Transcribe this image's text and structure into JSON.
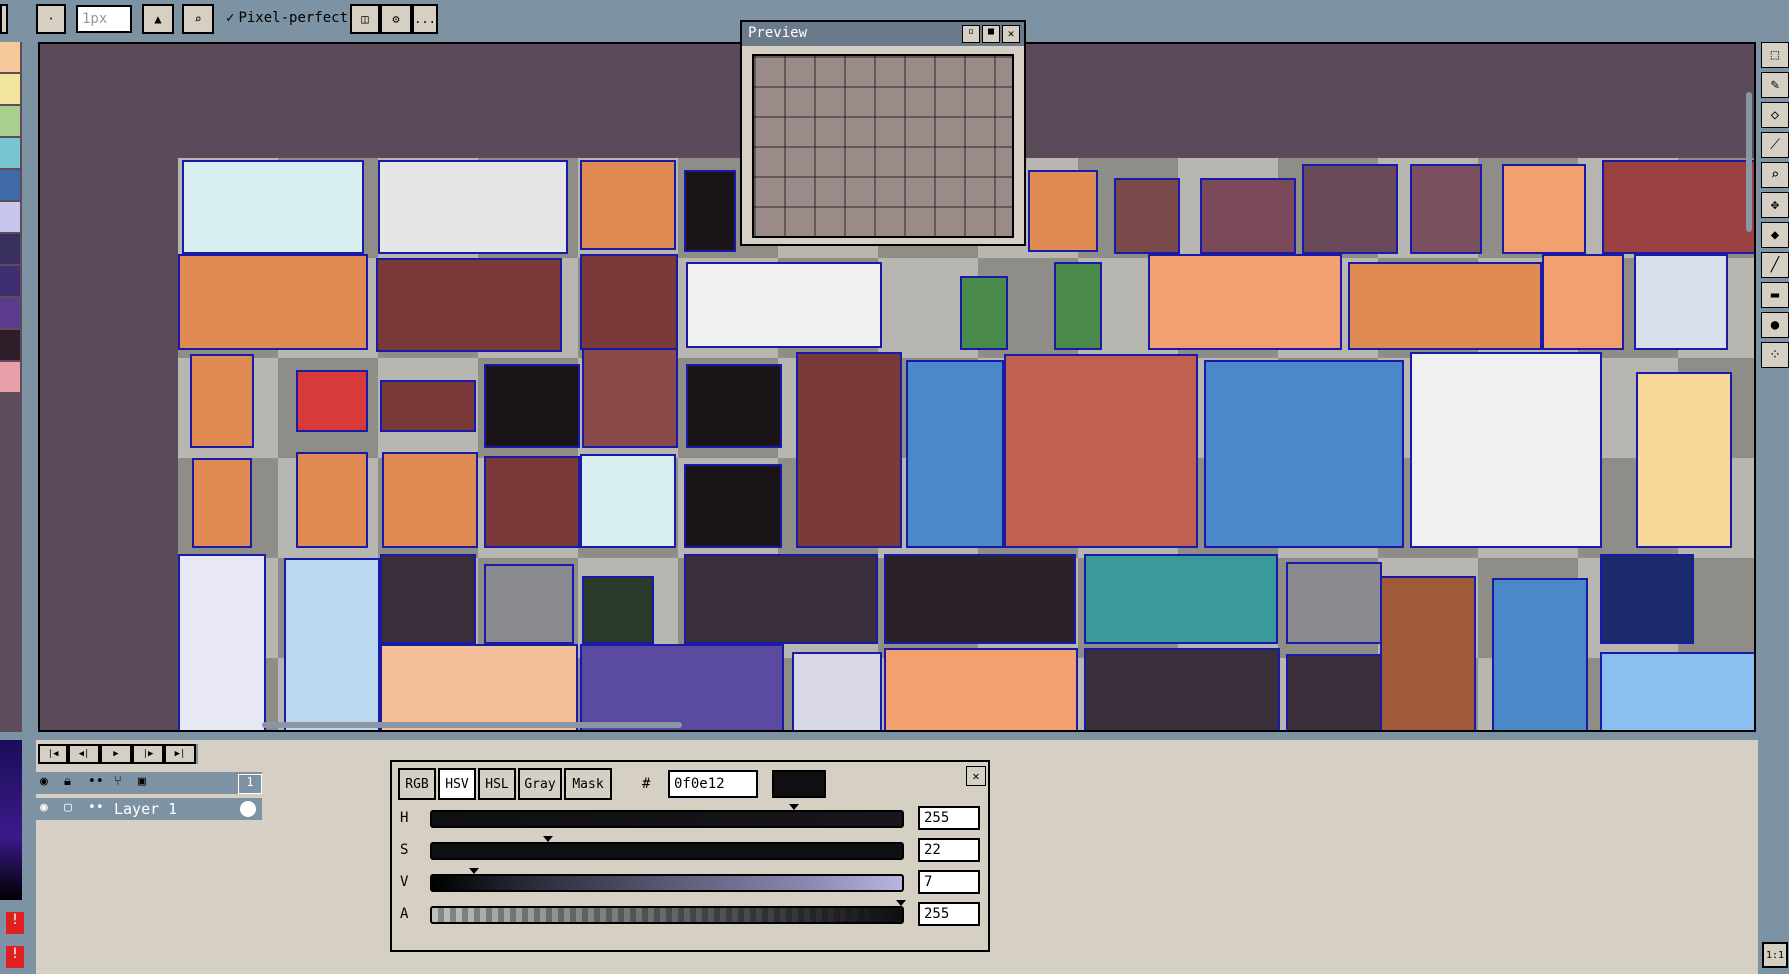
{
  "toolbar": {
    "brush_size": "1px",
    "pixel_perfect_label": "Pixel-perfect",
    "more_label": "..."
  },
  "palette": [
    "#f7c99a",
    "#f3e4a0",
    "#a8d08c",
    "#77c6d2",
    "#3f6aa8",
    "#c9c6ee",
    "#3a3060",
    "#3f2f72",
    "#5a3b8c",
    "#2e1d28",
    "#e7a0a8"
  ],
  "preview": {
    "title": "Preview"
  },
  "timeline": {
    "frame_number": "1",
    "layer_name": "Layer 1"
  },
  "color_panel": {
    "tabs": [
      "RGB",
      "HSV",
      "HSL",
      "Gray",
      "Mask"
    ],
    "active_tab": "HSV",
    "hash_label": "#",
    "hex_value": "0f0e12",
    "current_color": "#0f0e12",
    "sliders": [
      {
        "label": "H",
        "value": "255",
        "fraction": 0.77
      },
      {
        "label": "S",
        "value": "22",
        "fraction": 0.24
      },
      {
        "label": "V",
        "value": "7",
        "fraction": 0.08
      },
      {
        "label": "A",
        "value": "255",
        "fraction": 1.0
      }
    ]
  },
  "zoom_label": "1:1",
  "icons": [
    "marquee-icon",
    "pencil-icon",
    "eraser-icon",
    "eyedropper-icon",
    "zoom-icon",
    "move-icon",
    "fill-icon",
    "line-icon",
    "rect-icon",
    "ellipse-icon",
    "spray-icon"
  ]
}
